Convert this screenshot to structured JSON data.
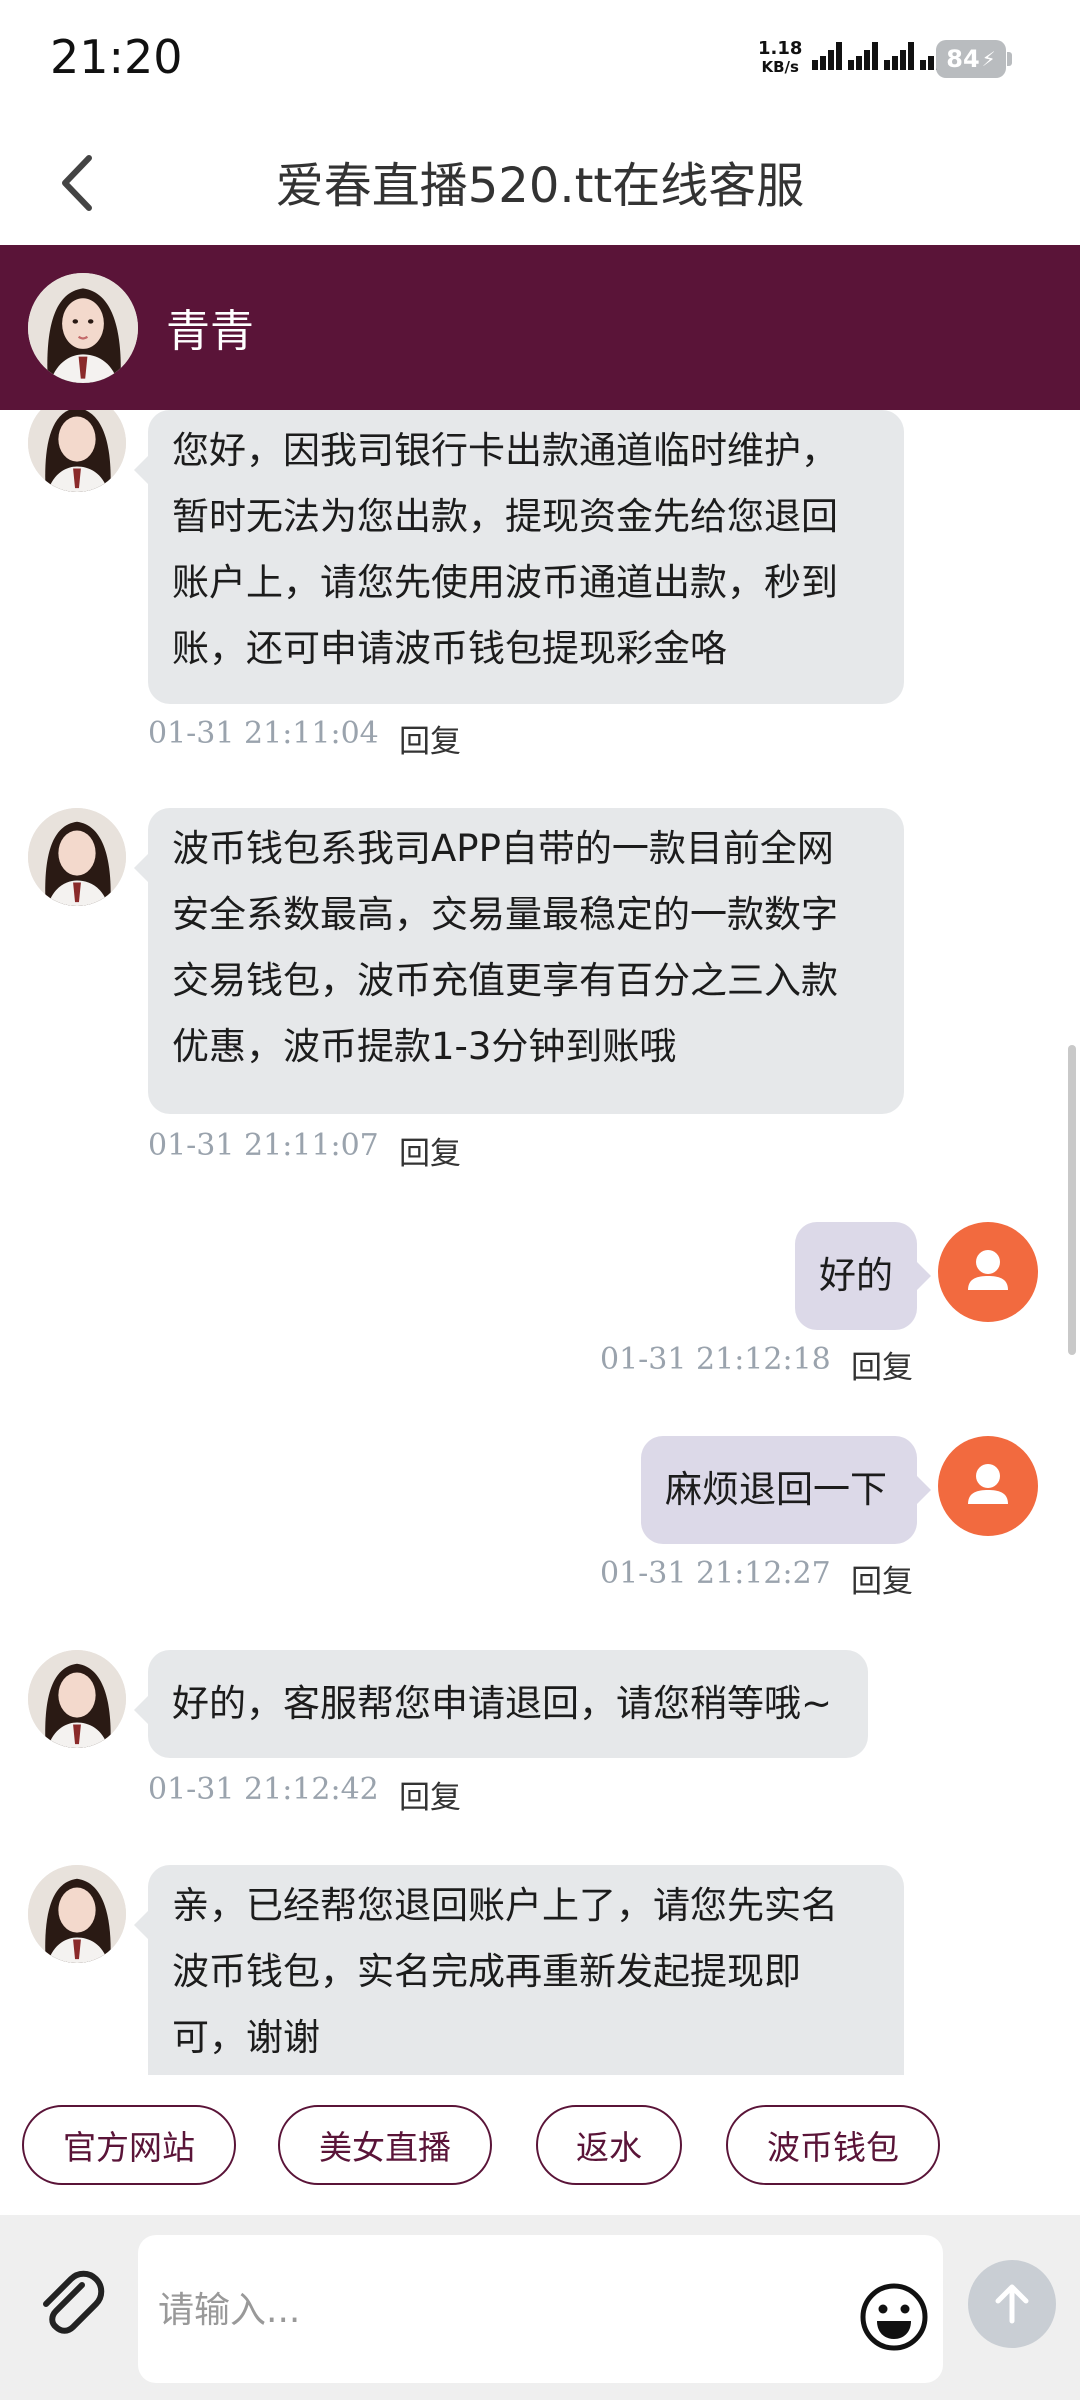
{
  "status_bar": {
    "time": "21:20",
    "net_speed_value": "1.18",
    "net_speed_unit": "KB/s",
    "battery": "84"
  },
  "header": {
    "title": "爱春直播520.tt在线客服",
    "back_icon": "chevron-left-icon"
  },
  "agent": {
    "name": "青青",
    "bar_color": "#5a1438"
  },
  "messages": [
    {
      "side": "in",
      "lines": [
        "您好，因我司银行卡出款通道临时维护，",
        "暂时无法为您出款，提现资金先给您退回",
        "账户上，请您先使用波币通道出款，秒到",
        "账，还可申请波币钱包提现彩金咯"
      ],
      "time": "01-31 21:11:04",
      "reply": "回复"
    },
    {
      "side": "in",
      "lines": [
        "波币钱包系我司APP自带的一款目前全网",
        "安全系数最高，交易量最稳定的一款数字",
        "交易钱包，波币充值更享有百分之三入款",
        "优惠，波币提款1-3分钟到账哦"
      ],
      "time": "01-31 21:11:07",
      "reply": "回复"
    },
    {
      "side": "out",
      "lines": [
        "好的"
      ],
      "time": "01-31 21:12:18",
      "reply": "回复"
    },
    {
      "side": "out",
      "lines": [
        "麻烦退回一下"
      ],
      "time": "01-31 21:12:27",
      "reply": "回复"
    },
    {
      "side": "in",
      "lines": [
        "好的，客服帮您申请退回，请您稍等哦~"
      ],
      "time": "01-31 21:12:42",
      "reply": "回复"
    },
    {
      "side": "in",
      "lines": [
        "亲，已经帮您退回账户上了，请您先实名",
        "波币钱包，实名完成再重新发起提现即",
        "可，谢谢"
      ],
      "time": "",
      "reply": ""
    }
  ],
  "quick_replies": [
    "官方网站",
    "美女直播",
    "返水",
    "波币钱包"
  ],
  "input": {
    "placeholder": "请输入...",
    "value": ""
  },
  "icons": {
    "attach": "paperclip-icon",
    "emoji": "smiley-icon",
    "send": "arrow-up-icon"
  },
  "colors": {
    "accent": "#5a1438",
    "user_avatar": "#f26a3f",
    "incoming_bubble": "#e6e8ea",
    "outgoing_bubble": "#dcd9e8"
  }
}
